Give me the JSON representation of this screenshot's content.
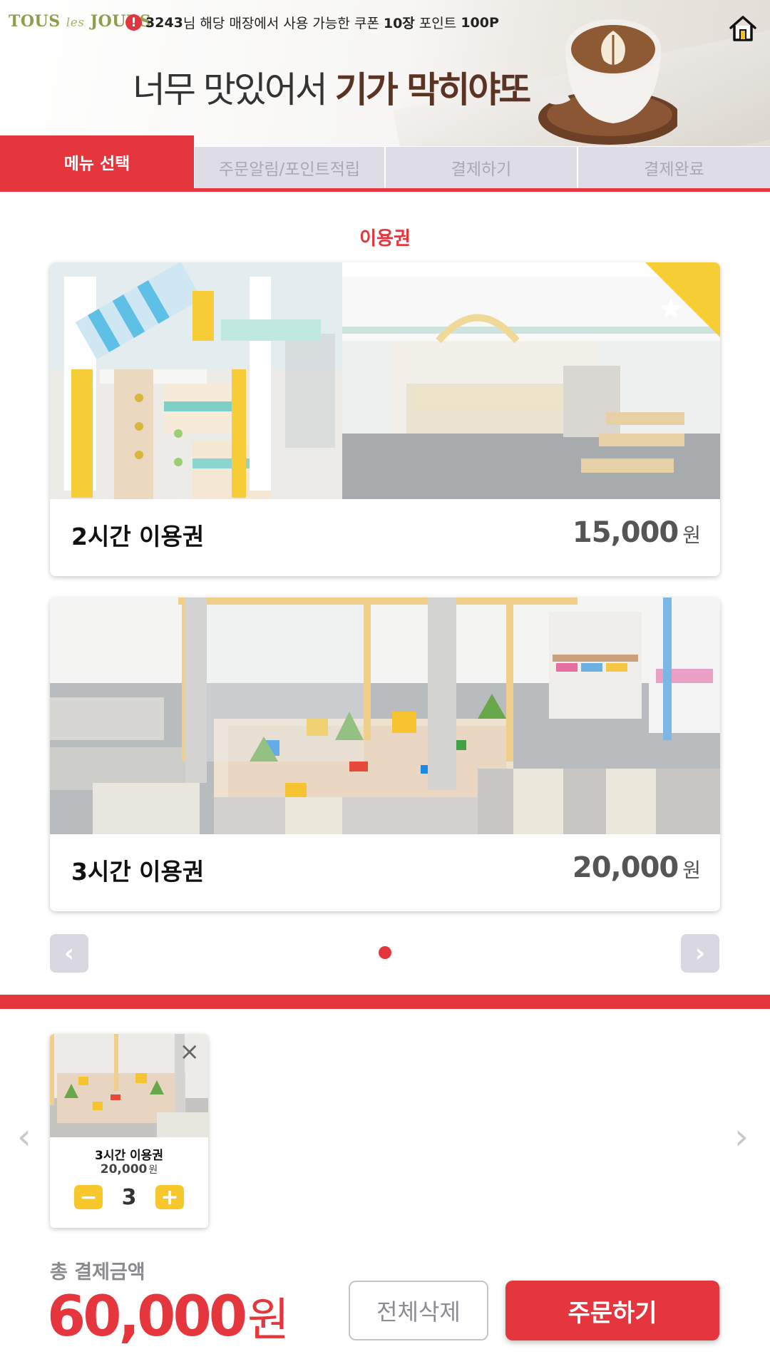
{
  "header": {
    "brand": "TOUS les JOURS",
    "brand_main": "TOUS",
    "brand_les": "les",
    "brand_end": "JOURS",
    "notice": {
      "member_no": "3243",
      "text_1": "님 해당 매장에서 사용 가능한 쿠폰 ",
      "coupon_count": "10장",
      "text_2": " 포인트 ",
      "points": "100P"
    },
    "slogan_plain": "너무 맛있어서 ",
    "slogan_emph_1": "기가 ",
    "slogan_emph_2": "막히야또"
  },
  "steps": [
    "메뉴 선택",
    "주문알림/포인트적립",
    "결제하기",
    "결제완료"
  ],
  "section_title": "이용권",
  "products": [
    {
      "name": "2시간 이용권",
      "price": "15,000",
      "unit": "원",
      "featured": true
    },
    {
      "name": "3시간 이용권",
      "price": "20,000",
      "unit": "원",
      "featured": false
    }
  ],
  "pager": {
    "prev": "‹",
    "next": "›",
    "current_page": 1,
    "total_pages": 1
  },
  "cart": {
    "items": [
      {
        "name": "3시간 이용권",
        "price": "20,000",
        "unit": "원",
        "quantity": "3",
        "remove": "×",
        "minus": "−",
        "plus": "+"
      }
    ],
    "prev": "‹",
    "next": "›"
  },
  "total": {
    "label": "총 결제금액",
    "amount": "60,000",
    "unit": "원"
  },
  "actions": {
    "clear": "전체삭제",
    "order": "주문하기"
  },
  "colors": {
    "accent": "#e5363d",
    "tab_inactive": "#dedde6",
    "yellow": "#f7c72b",
    "brand": "#8f9e4d"
  }
}
